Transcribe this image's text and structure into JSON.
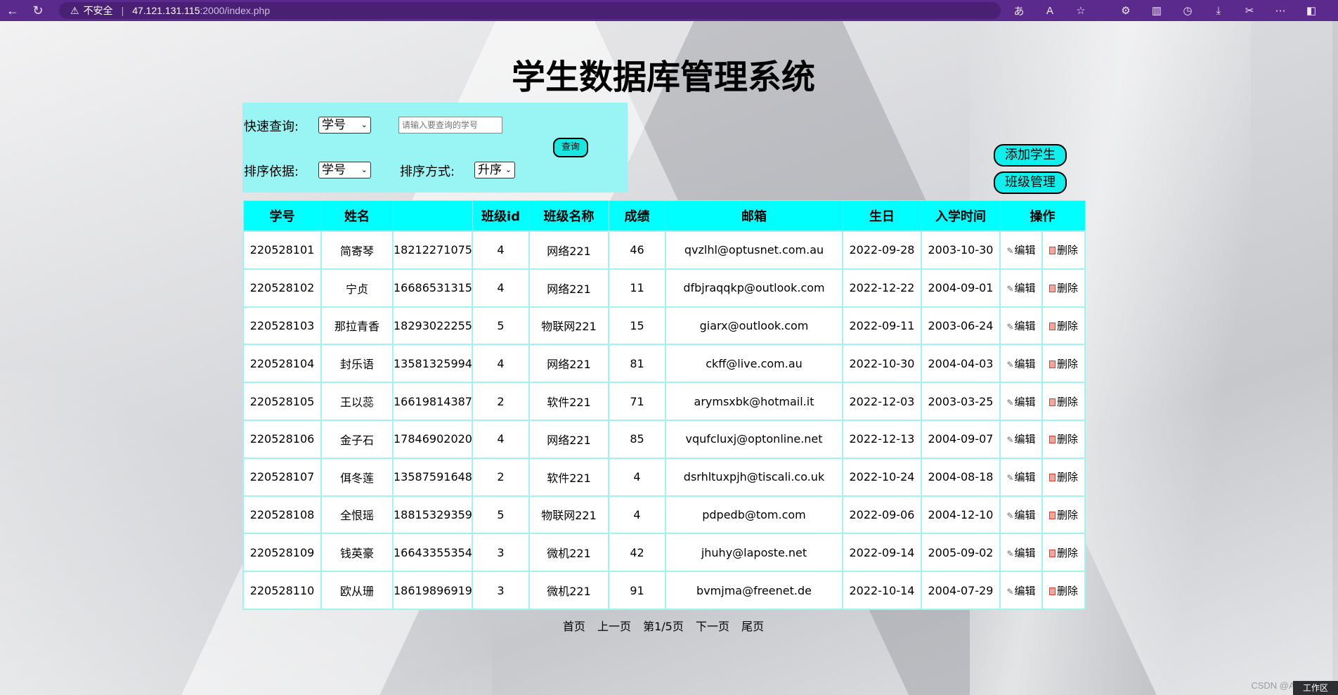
{
  "browser": {
    "security_label": "不安全",
    "url_host": "47.121.131.115",
    "url_path": ":2000/index.php"
  },
  "page": {
    "title": "学生数据库管理系统"
  },
  "search": {
    "quick_label": "快速查询:",
    "quick_field": "学号",
    "input_placeholder": "请输入要查询的学号",
    "sort_label": "排序依据:",
    "sort_field": "学号",
    "order_label": "排序方式:",
    "order_value": "升序",
    "query_button": "查询"
  },
  "actions": {
    "add_student": "添加学生",
    "class_manage": "班级管理"
  },
  "table": {
    "headers": [
      "学号",
      "姓名",
      "",
      "班级id",
      "班级名称",
      "成绩",
      "邮箱",
      "生日",
      "入学时间",
      "操作"
    ],
    "edit_label": "编辑",
    "delete_label": "删除",
    "rows": [
      [
        "220528101",
        "简寄琴",
        "18212271075",
        "4",
        "网络221",
        "46",
        "qvzlhl@optusnet.com.au",
        "2022-09-28",
        "2003-10-30"
      ],
      [
        "220528102",
        "宁贞",
        "16686531315",
        "4",
        "网络221",
        "11",
        "dfbjraqqkp@outlook.com",
        "2022-12-22",
        "2004-09-01"
      ],
      [
        "220528103",
        "那拉青香",
        "18293022255",
        "5",
        "物联网221",
        "15",
        "giarx@outlook.com",
        "2022-09-11",
        "2003-06-24"
      ],
      [
        "220528104",
        "封乐语",
        "13581325994",
        "4",
        "网络221",
        "81",
        "ckff@live.com.au",
        "2022-10-30",
        "2004-04-03"
      ],
      [
        "220528105",
        "王以蕊",
        "16619814387",
        "2",
        "软件221",
        "71",
        "arymsxbk@hotmail.it",
        "2022-12-03",
        "2003-03-25"
      ],
      [
        "220528106",
        "金子石",
        "17846902020",
        "4",
        "网络221",
        "85",
        "vqufcluxj@optonline.net",
        "2022-12-13",
        "2004-09-07"
      ],
      [
        "220528107",
        "佴冬莲",
        "13587591648",
        "2",
        "软件221",
        "4",
        "dsrhltuxpjh@tiscali.co.uk",
        "2022-10-24",
        "2004-08-18"
      ],
      [
        "220528108",
        "全恨瑶",
        "18815329359",
        "5",
        "物联网221",
        "4",
        "pdpedb@tom.com",
        "2022-09-06",
        "2004-12-10"
      ],
      [
        "220528109",
        "钱英豪",
        "16643355354",
        "3",
        "微机221",
        "42",
        "jhuhy@laposte.net",
        "2022-09-14",
        "2005-09-02"
      ],
      [
        "220528110",
        "欧从珊",
        "18619896919",
        "3",
        "微机221",
        "91",
        "bvmjma@freenet.de",
        "2022-10-14",
        "2004-07-29"
      ]
    ]
  },
  "pager": {
    "first": "首页",
    "prev": "上一页",
    "current": "第1/5页",
    "next": "下一页",
    "last": "尾页"
  },
  "footer": {
    "watermark": "CSDN @APP",
    "badge": "工作区"
  }
}
